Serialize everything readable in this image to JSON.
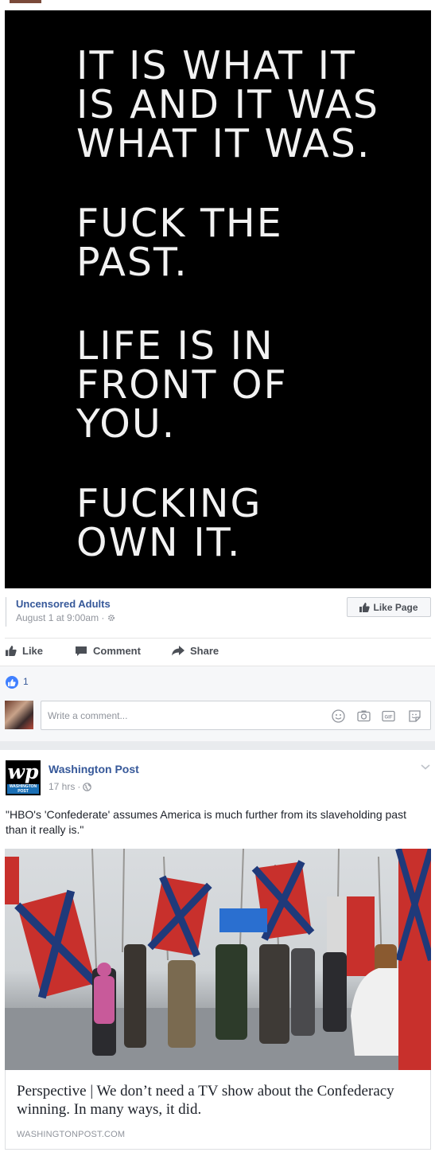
{
  "post1": {
    "meme_lines": [
      "IT IS WHAT IT\nIS AND IT WAS\nWHAT IT WAS.",
      "FUCK THE\nPAST.",
      "LIFE IS IN\nFRONT OF\nYOU.",
      "FUCKING\nOWN IT."
    ],
    "page_name": "Uncensored Adults",
    "time": "August 1 at 9:00am",
    "like_page_label": "Like Page",
    "actions": {
      "like": "Like",
      "comment": "Comment",
      "share": "Share"
    },
    "reaction_count": "1",
    "comment_placeholder": "Write a comment..."
  },
  "post2": {
    "publisher": "Washington Post",
    "time": "17 hrs",
    "text": "\"HBO's 'Confederate' assumes America is much further from its slaveholding past than it really is.\"",
    "link_title": "Perspective | We don’t need a TV show about the Confederacy winning. In many ways, it did.",
    "link_domain": "WASHINGTONPOST.COM",
    "logo_text": "wp",
    "logo_strip": "WASHINGTON POST"
  },
  "colors": {
    "link_blue": "#365899",
    "meta_gray": "#90949c",
    "like_blue": "#4080ff"
  },
  "icons": [
    "thumbs-up-icon",
    "comment-bubble-icon",
    "share-arrow-icon",
    "globe-icon",
    "gear-icon",
    "emoji-icon",
    "camera-icon",
    "gif-icon",
    "sticker-icon",
    "chevron-down-icon"
  ]
}
